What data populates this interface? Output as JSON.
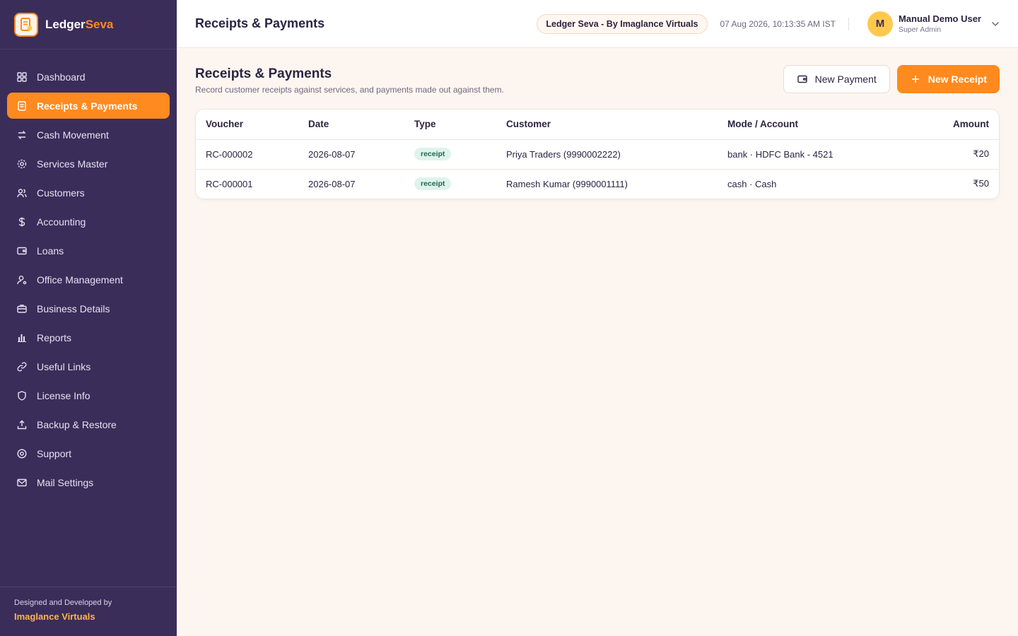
{
  "brand": {
    "name_part1": "Ledger",
    "name_part2": "Seva",
    "accent_color": "#ff8a1f",
    "logo_icon": "ledger-document-icon"
  },
  "sidebar": {
    "items": [
      {
        "label": "Dashboard",
        "icon": "dashboard-grid-icon",
        "active": false
      },
      {
        "label": "Receipts & Payments",
        "icon": "receipt-icon",
        "active": true
      },
      {
        "label": "Cash Movement",
        "icon": "arrows-exchange-icon",
        "active": false
      },
      {
        "label": "Services Master",
        "icon": "gear-icon",
        "active": false
      },
      {
        "label": "Customers",
        "icon": "users-icon",
        "active": false
      },
      {
        "label": "Accounting",
        "icon": "dollar-icon",
        "active": false
      },
      {
        "label": "Loans",
        "icon": "wallet-icon",
        "active": false
      },
      {
        "label": "Office Management",
        "icon": "user-cog-icon",
        "active": false
      },
      {
        "label": "Business Details",
        "icon": "briefcase-icon",
        "active": false
      },
      {
        "label": "Reports",
        "icon": "bar-chart-icon",
        "active": false
      },
      {
        "label": "Useful Links",
        "icon": "link-icon",
        "active": false
      },
      {
        "label": "License Info",
        "icon": "shield-icon",
        "active": false
      },
      {
        "label": "Backup & Restore",
        "icon": "upload-icon",
        "active": false
      },
      {
        "label": "Support",
        "icon": "support-icon",
        "active": false
      },
      {
        "label": "Mail Settings",
        "icon": "mail-icon",
        "active": false
      }
    ],
    "footer": {
      "line1": "Designed and Developed by",
      "line2": "Imaglance Virtuals"
    }
  },
  "header": {
    "title": "Receipts & Payments",
    "pill": "Ledger Seva - By Imaglance Virtuals",
    "datetime": "07 Aug 2026, 10:13:35 AM IST",
    "user": {
      "initial": "M",
      "name": "Manual Demo User",
      "role": "Super Admin"
    }
  },
  "main": {
    "title": "Receipts & Payments",
    "subtitle": "Record customer receipts against services, and payments made out against them.",
    "new_payment_label": "New Payment",
    "new_receipt_label": "New Receipt",
    "table": {
      "columns": [
        "Voucher",
        "Date",
        "Type",
        "Customer",
        "Mode / Account",
        "Amount"
      ],
      "rows": [
        {
          "voucher": "RC-000002",
          "date": "2026-08-07",
          "type": "receipt",
          "customer": "Priya Traders (9990002222)",
          "mode": "bank · HDFC Bank - 4521",
          "amount": "₹20"
        },
        {
          "voucher": "RC-000001",
          "date": "2026-08-07",
          "type": "receipt",
          "customer": "Ramesh Kumar (9990001111)",
          "mode": "cash · Cash",
          "amount": "₹50"
        }
      ]
    }
  }
}
